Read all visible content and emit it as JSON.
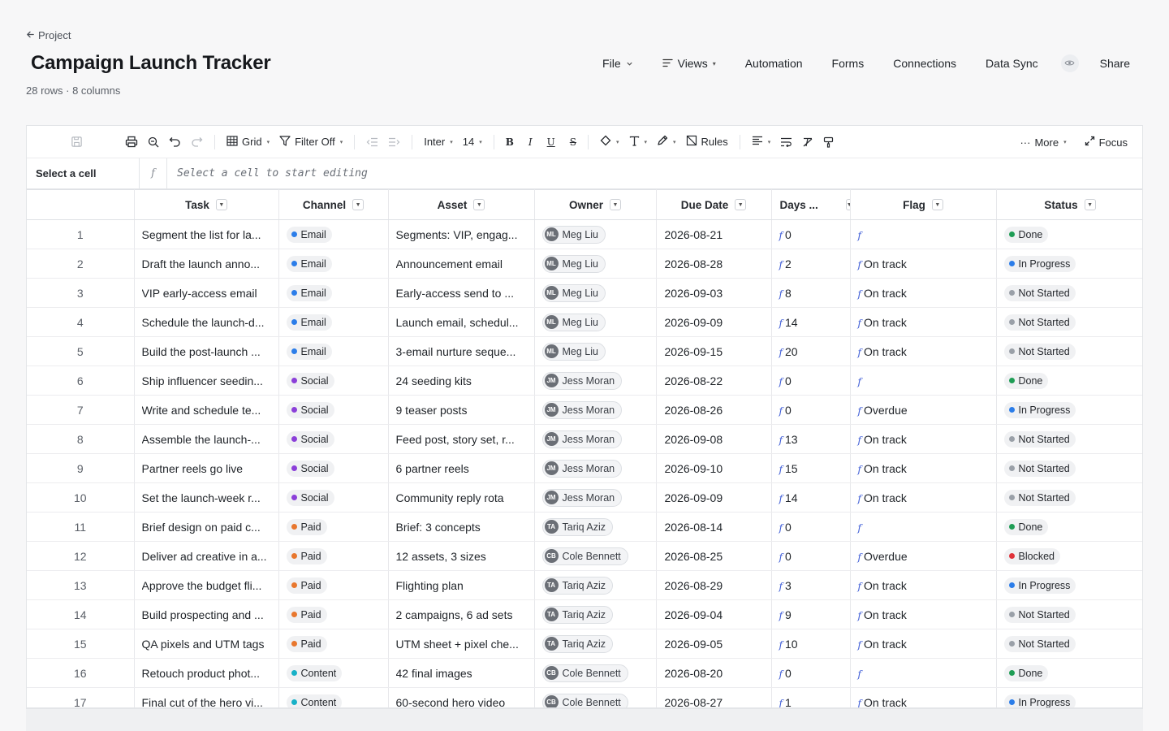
{
  "header": {
    "back_label": "Project",
    "title": "Campaign Launch Tracker",
    "meta": "28 rows · 8 columns"
  },
  "topnav": {
    "file": "File",
    "views": "Views",
    "automation": "Automation",
    "forms": "Forms",
    "connections": "Connections",
    "data_sync": "Data Sync",
    "share": "Share"
  },
  "toolbar": {
    "grid": "Grid",
    "filter": "Filter Off",
    "font": "Inter",
    "font_size": "14",
    "bold": "B",
    "italic": "I",
    "underline": "U",
    "strike": "S",
    "rules": "Rules",
    "more": "More",
    "focus": "Focus"
  },
  "formula_bar": {
    "cell_ref": "Select a cell",
    "fx": "f",
    "placeholder": "Select a cell to start editing"
  },
  "columns": [
    "Task",
    "Channel",
    "Asset",
    "Owner",
    "Due Date",
    "Days ...",
    "Flag",
    "Status"
  ],
  "colors": {
    "Email": "#2b7de9",
    "Social": "#8b3fd9",
    "Paid": "#e8772e",
    "Content": "#17b1c7",
    "Done": "#1f9d55",
    "In Progress": "#2b7de9",
    "Not Started": "#9aa0a8",
    "Blocked": "#e0323a"
  },
  "rows": [
    {
      "num": "1",
      "task": "Segment the list for la...",
      "channel": "Email",
      "asset": "Segments: VIP, engag...",
      "owner_initials": "ML",
      "owner": "Meg Liu",
      "due": "2026-08-21",
      "days": "0",
      "flag": "",
      "status": "Done"
    },
    {
      "num": "2",
      "task": "Draft the launch anno...",
      "channel": "Email",
      "asset": "Announcement email",
      "owner_initials": "ML",
      "owner": "Meg Liu",
      "due": "2026-08-28",
      "days": "2",
      "flag": "On track",
      "status": "In Progress"
    },
    {
      "num": "3",
      "task": "VIP early-access email",
      "channel": "Email",
      "asset": "Early-access send to ...",
      "owner_initials": "ML",
      "owner": "Meg Liu",
      "due": "2026-09-03",
      "days": "8",
      "flag": "On track",
      "status": "Not Started"
    },
    {
      "num": "4",
      "task": "Schedule the launch-d...",
      "channel": "Email",
      "asset": "Launch email, schedul...",
      "owner_initials": "ML",
      "owner": "Meg Liu",
      "due": "2026-09-09",
      "days": "14",
      "flag": "On track",
      "status": "Not Started"
    },
    {
      "num": "5",
      "task": "Build the post-launch ...",
      "channel": "Email",
      "asset": "3-email nurture seque...",
      "owner_initials": "ML",
      "owner": "Meg Liu",
      "due": "2026-09-15",
      "days": "20",
      "flag": "On track",
      "status": "Not Started"
    },
    {
      "num": "6",
      "task": "Ship influencer seedin...",
      "channel": "Social",
      "asset": "24 seeding kits",
      "owner_initials": "JM",
      "owner": "Jess Moran",
      "due": "2026-08-22",
      "days": "0",
      "flag": "",
      "status": "Done"
    },
    {
      "num": "7",
      "task": "Write and schedule te...",
      "channel": "Social",
      "asset": "9 teaser posts",
      "owner_initials": "JM",
      "owner": "Jess Moran",
      "due": "2026-08-26",
      "days": "0",
      "flag": "Overdue",
      "status": "In Progress"
    },
    {
      "num": "8",
      "task": "Assemble the launch-...",
      "channel": "Social",
      "asset": "Feed post, story set, r...",
      "owner_initials": "JM",
      "owner": "Jess Moran",
      "due": "2026-09-08",
      "days": "13",
      "flag": "On track",
      "status": "Not Started"
    },
    {
      "num": "9",
      "task": "Partner reels go live",
      "channel": "Social",
      "asset": "6 partner reels",
      "owner_initials": "JM",
      "owner": "Jess Moran",
      "due": "2026-09-10",
      "days": "15",
      "flag": "On track",
      "status": "Not Started"
    },
    {
      "num": "10",
      "task": "Set the launch-week r...",
      "channel": "Social",
      "asset": "Community reply rota",
      "owner_initials": "JM",
      "owner": "Jess Moran",
      "due": "2026-09-09",
      "days": "14",
      "flag": "On track",
      "status": "Not Started"
    },
    {
      "num": "11",
      "task": "Brief design on paid c...",
      "channel": "Paid",
      "asset": "Brief: 3 concepts",
      "owner_initials": "TA",
      "owner": "Tariq Aziz",
      "due": "2026-08-14",
      "days": "0",
      "flag": "",
      "status": "Done"
    },
    {
      "num": "12",
      "task": "Deliver ad creative in a...",
      "channel": "Paid",
      "asset": "12 assets, 3 sizes",
      "owner_initials": "CB",
      "owner": "Cole Bennett",
      "due": "2026-08-25",
      "days": "0",
      "flag": "Overdue",
      "status": "Blocked"
    },
    {
      "num": "13",
      "task": "Approve the budget fli...",
      "channel": "Paid",
      "asset": "Flighting plan",
      "owner_initials": "TA",
      "owner": "Tariq Aziz",
      "due": "2026-08-29",
      "days": "3",
      "flag": "On track",
      "status": "In Progress"
    },
    {
      "num": "14",
      "task": "Build prospecting and ...",
      "channel": "Paid",
      "asset": "2 campaigns, 6 ad sets",
      "owner_initials": "TA",
      "owner": "Tariq Aziz",
      "due": "2026-09-04",
      "days": "9",
      "flag": "On track",
      "status": "Not Started"
    },
    {
      "num": "15",
      "task": "QA pixels and UTM tags",
      "channel": "Paid",
      "asset": "UTM sheet + pixel che...",
      "owner_initials": "TA",
      "owner": "Tariq Aziz",
      "due": "2026-09-05",
      "days": "10",
      "flag": "On track",
      "status": "Not Started"
    },
    {
      "num": "16",
      "task": "Retouch product phot...",
      "channel": "Content",
      "asset": "42 final images",
      "owner_initials": "CB",
      "owner": "Cole Bennett",
      "due": "2026-08-20",
      "days": "0",
      "flag": "",
      "status": "Done"
    },
    {
      "num": "17",
      "task": "Final cut of the hero vi...",
      "channel": "Content",
      "asset": "60-second hero video",
      "owner_initials": "CB",
      "owner": "Cole Bennett",
      "due": "2026-08-27",
      "days": "1",
      "flag": "On track",
      "status": "In Progress"
    }
  ]
}
